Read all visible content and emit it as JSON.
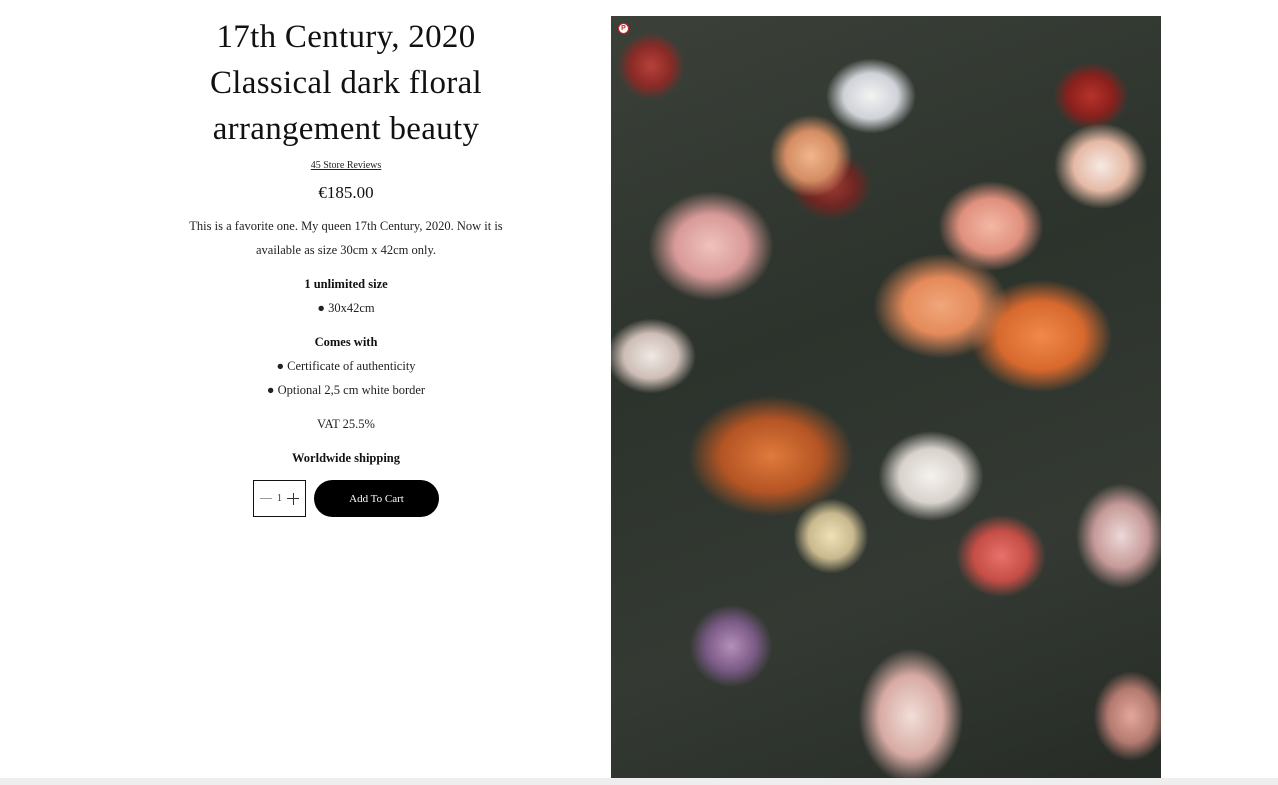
{
  "product": {
    "title_lines": [
      "17th Century, 2020",
      "Classical dark floral",
      "arrangement beauty"
    ],
    "reviews_link": "45 Store Reviews",
    "price": "€185.00",
    "description": "This is a favorite one. My queen 17th Century, 2020. Now it is available as size 30cm x 42cm only.",
    "size_heading": "1 unlimited size",
    "size_item": "● 30x42cm",
    "comes_with_heading": "Comes with",
    "comes_with_items": [
      "● Certificate of authenticity",
      "● Optional 2,5 cm white border"
    ],
    "vat": "VAT 25.5%",
    "shipping": "Worldwide shipping"
  },
  "cart": {
    "quantity": "1",
    "add_label": "Add To Cart",
    "minus_icon": "minus-icon",
    "plus_icon": "plus-icon"
  },
  "image": {
    "description_icon": "pinterest-icon",
    "pin_glyph": "P"
  },
  "colors": {
    "button_bg": "#000000",
    "pinterest": "#c8232c"
  }
}
